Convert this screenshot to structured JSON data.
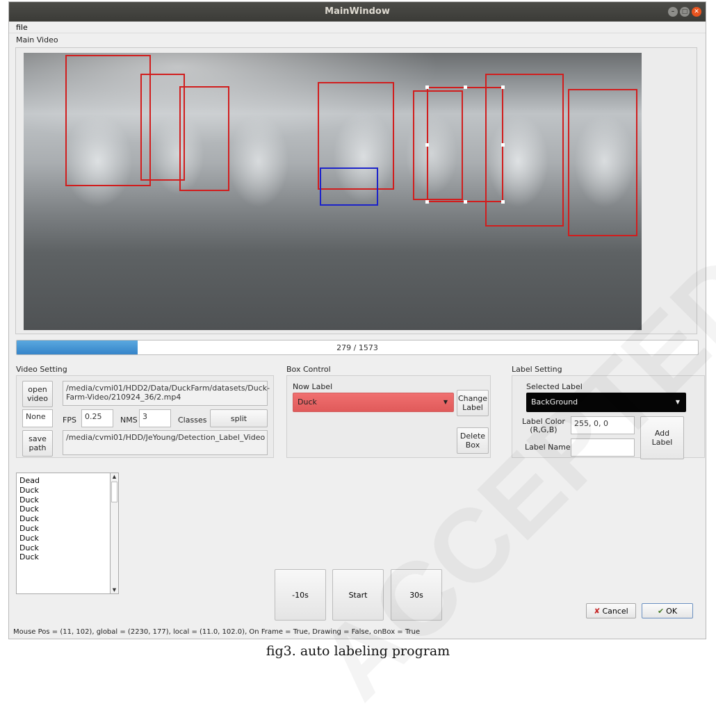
{
  "window": {
    "title": "MainWindow",
    "controls": [
      "minimize",
      "maximize",
      "close"
    ]
  },
  "menu": {
    "file": "file"
  },
  "main_video": {
    "label": "Main Video",
    "boxes_red": 9,
    "boxes_blue": 1
  },
  "progress": {
    "text": "279 / 1573",
    "current": 279,
    "total": 1573
  },
  "video_setting": {
    "title": "Video Setting",
    "open_button": "open\nvideo",
    "video_path": "/media/cvmi01/HDD2/Data/DuckFarm/datasets/Duck-Farm-Video/210924_36/2.mp4",
    "none_value": "None",
    "fps_label": "FPS",
    "fps_value": "0.25",
    "nms_label": "NMS",
    "nms_value": "3",
    "classes_label": "Classes",
    "split_button": "split",
    "save_button": "save\npath",
    "save_path": "/media/cvmi01/HDD/JeYoung/Detection_Label_Video"
  },
  "box_control": {
    "title": "Box Control",
    "now_label": "Now Label",
    "selected_value": "Duck",
    "selected_color": "#f07070",
    "change_button": "Change\nLabel",
    "delete_button": "Delete\nBox"
  },
  "label_setting": {
    "title": "Label Setting",
    "selected_label": "Selected Label",
    "selected_value": "BackGround",
    "color_label": "Label Color\n(R,G,B)",
    "color_value": "255, 0, 0",
    "name_label": "Label Name",
    "name_value": "",
    "add_button": "Add\nLabel"
  },
  "label_list": [
    "Dead",
    "Duck",
    "Duck",
    "Duck",
    "Duck",
    "Duck",
    "Duck",
    "Duck",
    "Duck"
  ],
  "playback": {
    "back": "-10s",
    "start": "Start",
    "forward": "30s"
  },
  "dialog": {
    "cancel": "Cancel",
    "ok": "OK"
  },
  "status_text": "Mouse Pos = (11, 102), global = (2230, 177), local = (11.0, 102.0), On Frame = True, Drawing = False, onBox = True",
  "caption": "fig3.  auto labeling program",
  "watermark": "ACCEPTED",
  "colors": {
    "bbox_red": "#d11d1d",
    "bbox_blue": "#1c23c9",
    "progress": "#3584c9",
    "title_bar": "#3f3f3b",
    "combo_dark": "#050505"
  }
}
